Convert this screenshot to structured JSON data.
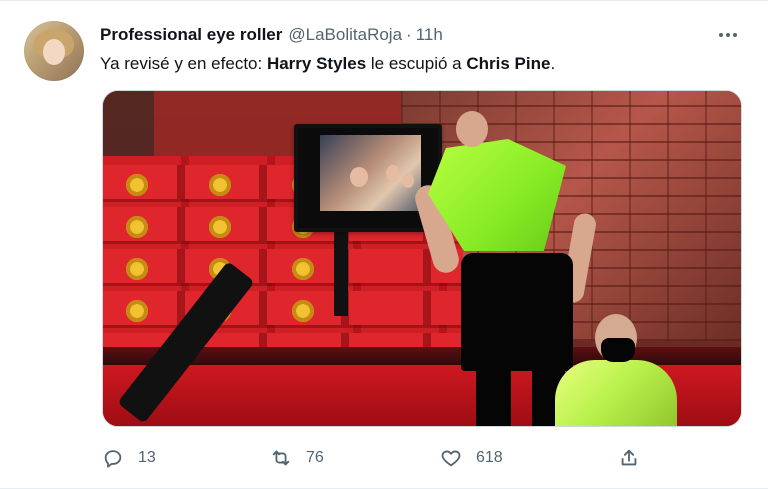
{
  "tweet": {
    "author": {
      "display_name": "Professional eye roller",
      "handle": "@LaBolitaRoja",
      "separator": "·",
      "time": "11h"
    },
    "text": {
      "part1": "Ya revisé y en efecto: ",
      "bold1": "Harry Styles",
      "part2": " le escupió a ",
      "bold2": "Chris Pine",
      "part3": "."
    },
    "actions": {
      "reply_count": "13",
      "retweet_count": "76",
      "like_count": "618"
    }
  },
  "icons": {
    "more": "more-horizontal-icon",
    "reply": "reply-icon",
    "retweet": "retweet-icon",
    "like": "heart-icon",
    "share": "share-icon"
  },
  "colors": {
    "text": "#0f1419",
    "secondary": "#536471",
    "border": "#cfd9de"
  }
}
